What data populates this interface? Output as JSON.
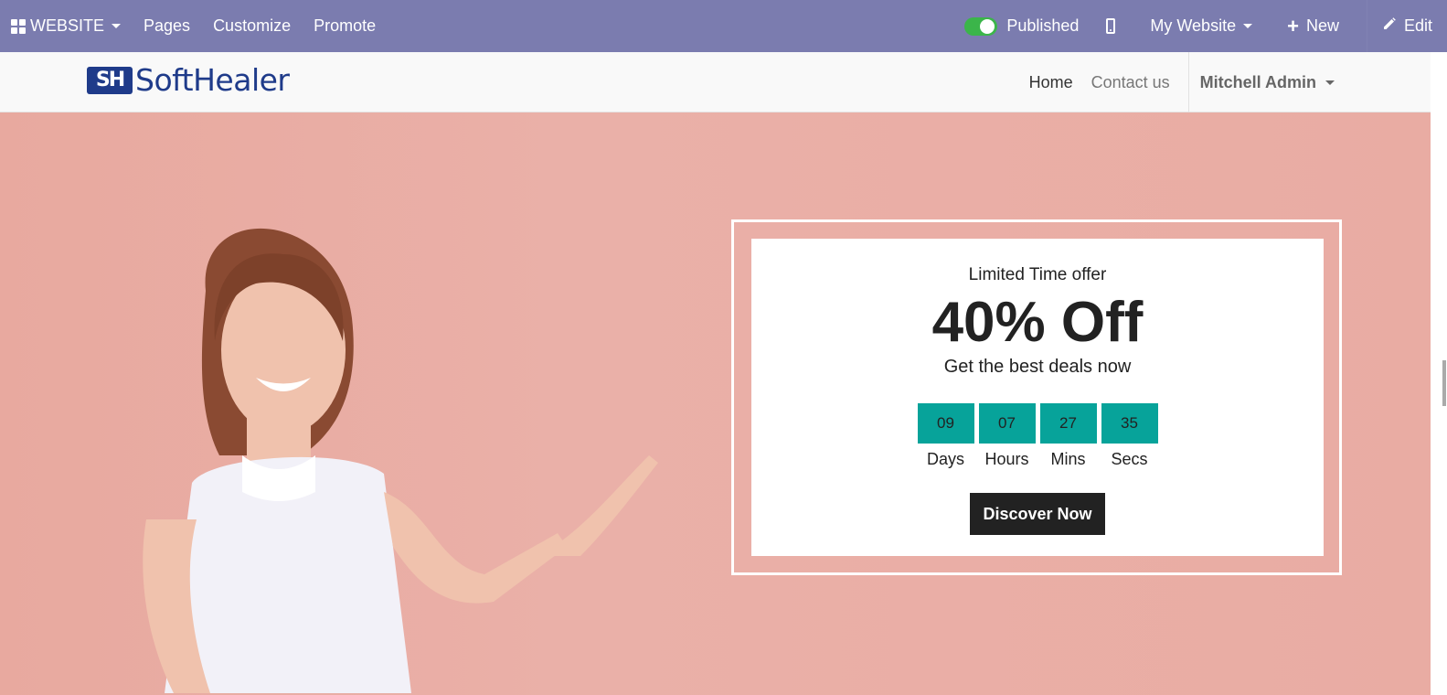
{
  "topbar": {
    "apps_label": "WEBSITE",
    "pages_label": "Pages",
    "customize_label": "Customize",
    "promote_label": "Promote",
    "published_label": "Published",
    "site_selector_label": "My Website",
    "new_label": "New",
    "edit_label": "Edit"
  },
  "header": {
    "logo_mark": "SH",
    "logo_text": "SoftHealer",
    "menu": {
      "home": "Home",
      "contact": "Contact us",
      "user": "Mitchell Admin"
    }
  },
  "offer": {
    "kicker": "Limited Time offer",
    "title": "40% Off",
    "subtitle": "Get the best deals now",
    "countdown": [
      {
        "value": "09",
        "label": "Days"
      },
      {
        "value": "07",
        "label": "Hours"
      },
      {
        "value": "27",
        "label": "Mins"
      },
      {
        "value": "35",
        "label": "Secs"
      }
    ],
    "cta_label": "Discover Now"
  },
  "colors": {
    "topbar": "#7b7caf",
    "hero_background": "#e9aaa1",
    "countdown_box": "#07a39a",
    "brand_blue": "#1f3b8a"
  },
  "icons": [
    "apps-grid-icon",
    "mobile-preview-icon",
    "plus-icon",
    "pencil-icon"
  ]
}
